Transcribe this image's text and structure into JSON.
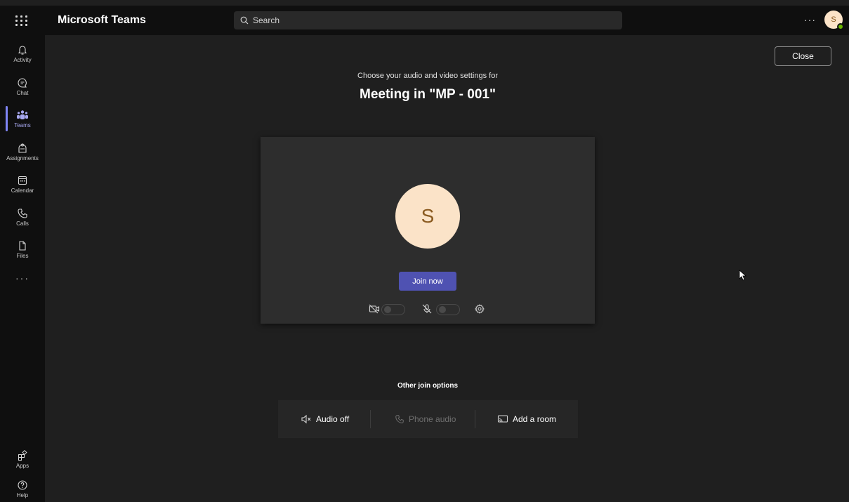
{
  "app": {
    "title": "Microsoft Teams"
  },
  "search": {
    "placeholder": "Search"
  },
  "header": {
    "more": "···",
    "avatar_initial": "S"
  },
  "rail": {
    "items": [
      {
        "label": "Activity",
        "icon": "bell-icon"
      },
      {
        "label": "Chat",
        "icon": "chat-icon"
      },
      {
        "label": "Teams",
        "icon": "teams-icon",
        "active": true
      },
      {
        "label": "Assignments",
        "icon": "assignments-icon"
      },
      {
        "label": "Calendar",
        "icon": "calendar-icon"
      },
      {
        "label": "Calls",
        "icon": "phone-icon"
      },
      {
        "label": "Files",
        "icon": "file-icon"
      }
    ],
    "more": "···",
    "bottom": [
      {
        "label": "Apps",
        "icon": "apps-icon"
      },
      {
        "label": "Help",
        "icon": "help-icon"
      }
    ]
  },
  "prejoin": {
    "close_label": "Close",
    "subtitle": "Choose your audio and video settings for",
    "meeting_title": "Meeting in \"MP - 001\"",
    "avatar_initial": "S",
    "join_label": "Join now",
    "camera_on": false,
    "mic_on": false
  },
  "other_options": {
    "title": "Other join options",
    "audio_off": "Audio off",
    "phone_audio": "Phone audio",
    "add_room": "Add a room"
  },
  "colors": {
    "accent": "#4f52b2",
    "active_rail": "#7f85f5",
    "avatar_bg": "#fbe3c8",
    "avatar_text": "#8a5a20",
    "presence": "#6bb700"
  }
}
